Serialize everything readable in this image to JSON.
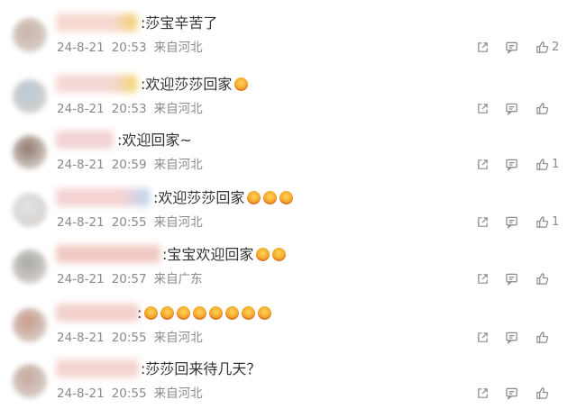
{
  "comments": [
    {
      "text": ":莎宝辛苦了",
      "emoji_count": 0,
      "date": "24-8-21",
      "time": "20:53",
      "location": "来自河北",
      "likes": "2",
      "avatar_color": "#c9b2a8",
      "nick_color": "#f6d8d0",
      "nick_accent": "#f2cf6c"
    },
    {
      "text": ":欢迎莎莎回家",
      "emoji_count": 1,
      "date": "24-8-21",
      "time": "20:53",
      "location": "来自河北",
      "likes": "",
      "avatar_color": "#b7c9d8",
      "nick_color": "#f4d7d2",
      "nick_accent": "#f5d46a"
    },
    {
      "text": ":欢迎回家~",
      "emoji_count": 0,
      "date": "24-8-21",
      "time": "20:59",
      "location": "来自河北",
      "likes": "1",
      "avatar_color": "#8f7a6e",
      "nick_color": "#f3d2d2",
      "nick_accent": "#f3d2d2"
    },
    {
      "text": ":欢迎莎莎回家",
      "emoji_count": 3,
      "date": "24-8-21",
      "time": "20:55",
      "location": "来自河北",
      "likes": "1",
      "avatar_color": "#dfe3e8",
      "nick_color": "#f5d2d2",
      "nick_accent": "#b9d4f0"
    },
    {
      "text": ":宝宝欢迎回家",
      "emoji_count": 2,
      "date": "24-8-21",
      "time": "20:57",
      "location": "来自广东",
      "likes": "",
      "avatar_color": "#a8aaa6",
      "nick_color": "#f1c9c3",
      "nick_accent": "#f1c9c3"
    },
    {
      "text": ":",
      "emoji_count": 8,
      "date": "24-8-21",
      "time": "20:55",
      "location": "来自河北",
      "likes": "",
      "avatar_color": "#c99a8c",
      "nick_color": "#f3d0cc",
      "nick_accent": "#f3d0cc"
    },
    {
      "text": ":莎莎回来待几天？",
      "emoji_count": 0,
      "date": "24-8-21",
      "time": "20:55",
      "location": "来自河北",
      "likes": "",
      "avatar_color": "#c7a79c",
      "nick_color": "#f4d4cf",
      "nick_accent": "#f4d4cf"
    }
  ],
  "icons": {
    "share": "share-icon",
    "comment": "comment-icon",
    "like": "thumbs-up-icon"
  },
  "colors": {
    "text": "#333333",
    "meta": "#8a8a8a",
    "icon": "#8a8a8a",
    "background": "#ffffff"
  }
}
